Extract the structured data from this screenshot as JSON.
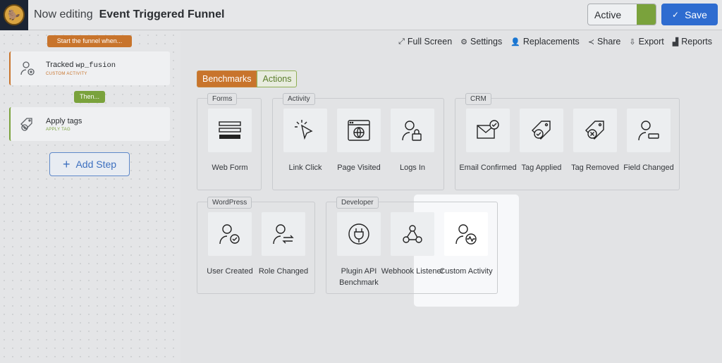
{
  "header": {
    "now_editing": "Now editing",
    "funnel_title": "Event Triggered Funnel",
    "status_label": "Active",
    "save_label": "Save",
    "accent_color": "#2e6cd0"
  },
  "toolbar": {
    "items": [
      "Full Screen",
      "Settings",
      "Replacements",
      "Share",
      "Export",
      "Reports"
    ]
  },
  "flow": {
    "start_label": "Start the funnel when...",
    "then_label": "Then...",
    "steps": [
      {
        "name": "Tracked",
        "code": "wp_fusion",
        "sub": "CUSTOM ACTIVITY",
        "icon": "user-plus-icon"
      },
      {
        "name": "Apply tags",
        "code": "",
        "sub": "APPLY TAG",
        "icon": "tag-plus-icon"
      }
    ],
    "add_step_label": "Add Step"
  },
  "tabs": {
    "benchmarks": "Benchmarks",
    "actions": "Actions"
  },
  "groups": {
    "forms": {
      "label": "Forms",
      "items": [
        "Web Form"
      ]
    },
    "activity": {
      "label": "Activity",
      "items": [
        "Link Click",
        "Page Visited",
        "Logs In"
      ]
    },
    "crm": {
      "label": "CRM",
      "items": [
        "Email Confirmed",
        "Tag Applied",
        "Tag Removed",
        "Field Changed"
      ]
    },
    "wordpress": {
      "label": "WordPress",
      "items": [
        "User Created",
        "Role Changed"
      ]
    },
    "developer": {
      "label": "Developer",
      "items": [
        "Plugin API Benchmark",
        "Webhook Listener",
        "Custom Activity"
      ]
    }
  }
}
